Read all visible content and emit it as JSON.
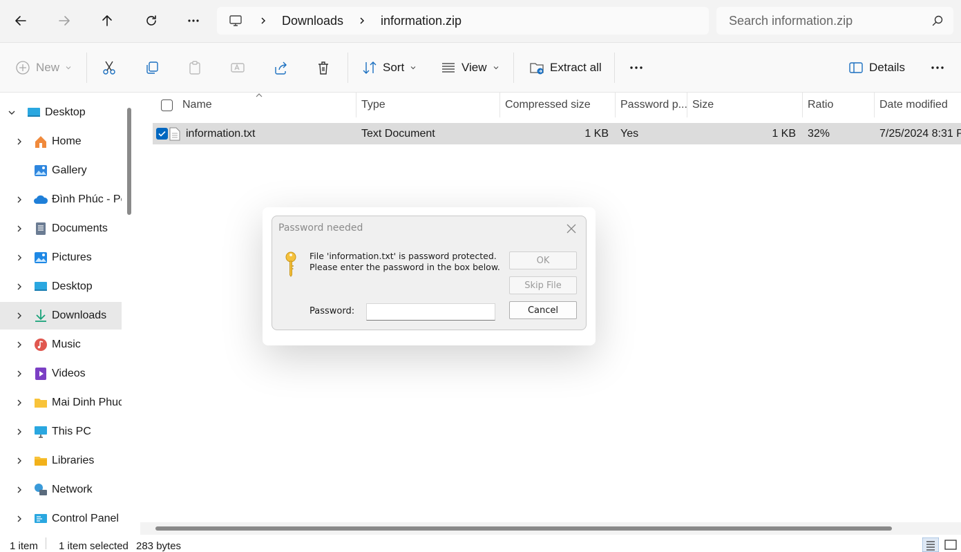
{
  "addressbar": {
    "breadcrumbs": [
      "Downloads",
      "information.zip"
    ],
    "search_placeholder": "Search information.zip"
  },
  "toolbar": {
    "new_label": "New",
    "sort_label": "Sort",
    "view_label": "View",
    "extract_label": "Extract all",
    "details_label": "Details"
  },
  "sidebar": {
    "items": [
      {
        "label": "Desktop",
        "icon": "desktop-icon",
        "level": 0,
        "expanded": true
      },
      {
        "label": "Home",
        "icon": "home-icon",
        "level": 1
      },
      {
        "label": "Gallery",
        "icon": "gallery-icon",
        "level": 1
      },
      {
        "label": "Đình Phúc - Pe",
        "icon": "onedrive-icon",
        "level": 1
      },
      {
        "label": "Documents",
        "icon": "documents-icon",
        "level": 1
      },
      {
        "label": "Pictures",
        "icon": "pictures-icon",
        "level": 1
      },
      {
        "label": "Desktop",
        "icon": "desktop-icon",
        "level": 1
      },
      {
        "label": "Downloads",
        "icon": "download-icon",
        "level": 1,
        "selected": true
      },
      {
        "label": "Music",
        "icon": "music-icon",
        "level": 1
      },
      {
        "label": "Videos",
        "icon": "videos-icon",
        "level": 1
      },
      {
        "label": "Mai Dinh Phuc",
        "icon": "folder-icon",
        "level": 1
      },
      {
        "label": "This PC",
        "icon": "this-pc-icon",
        "level": 1
      },
      {
        "label": "Libraries",
        "icon": "libraries-icon",
        "level": 1
      },
      {
        "label": "Network",
        "icon": "network-icon",
        "level": 1
      },
      {
        "label": "Control Panel",
        "icon": "control-panel-icon",
        "level": 1
      }
    ]
  },
  "filelist": {
    "columns": [
      "Name",
      "Type",
      "Compressed size",
      "Password p...",
      "Size",
      "Ratio",
      "Date modified"
    ],
    "rows": [
      {
        "name": "information.txt",
        "type": "Text Document",
        "compressed_size": "1 KB",
        "password": "Yes",
        "size": "1 KB",
        "ratio": "32%",
        "date": "7/25/2024 8:31 P"
      }
    ]
  },
  "dialog": {
    "title": "Password needed",
    "message_line1": "File 'information.txt' is password protected.",
    "message_line2": "Please enter the password in the box below.",
    "ok_label": "OK",
    "skip_label": "Skip File",
    "cancel_label": "Cancel",
    "password_label": "Password:",
    "password_value": ""
  },
  "statusbar": {
    "item_count": "1 item",
    "selection": "1 item selected",
    "size": "283 bytes"
  },
  "colors": {
    "accent": "#0067c0",
    "selected_row": "#dcdcdc",
    "folder": "#f8c33a"
  }
}
